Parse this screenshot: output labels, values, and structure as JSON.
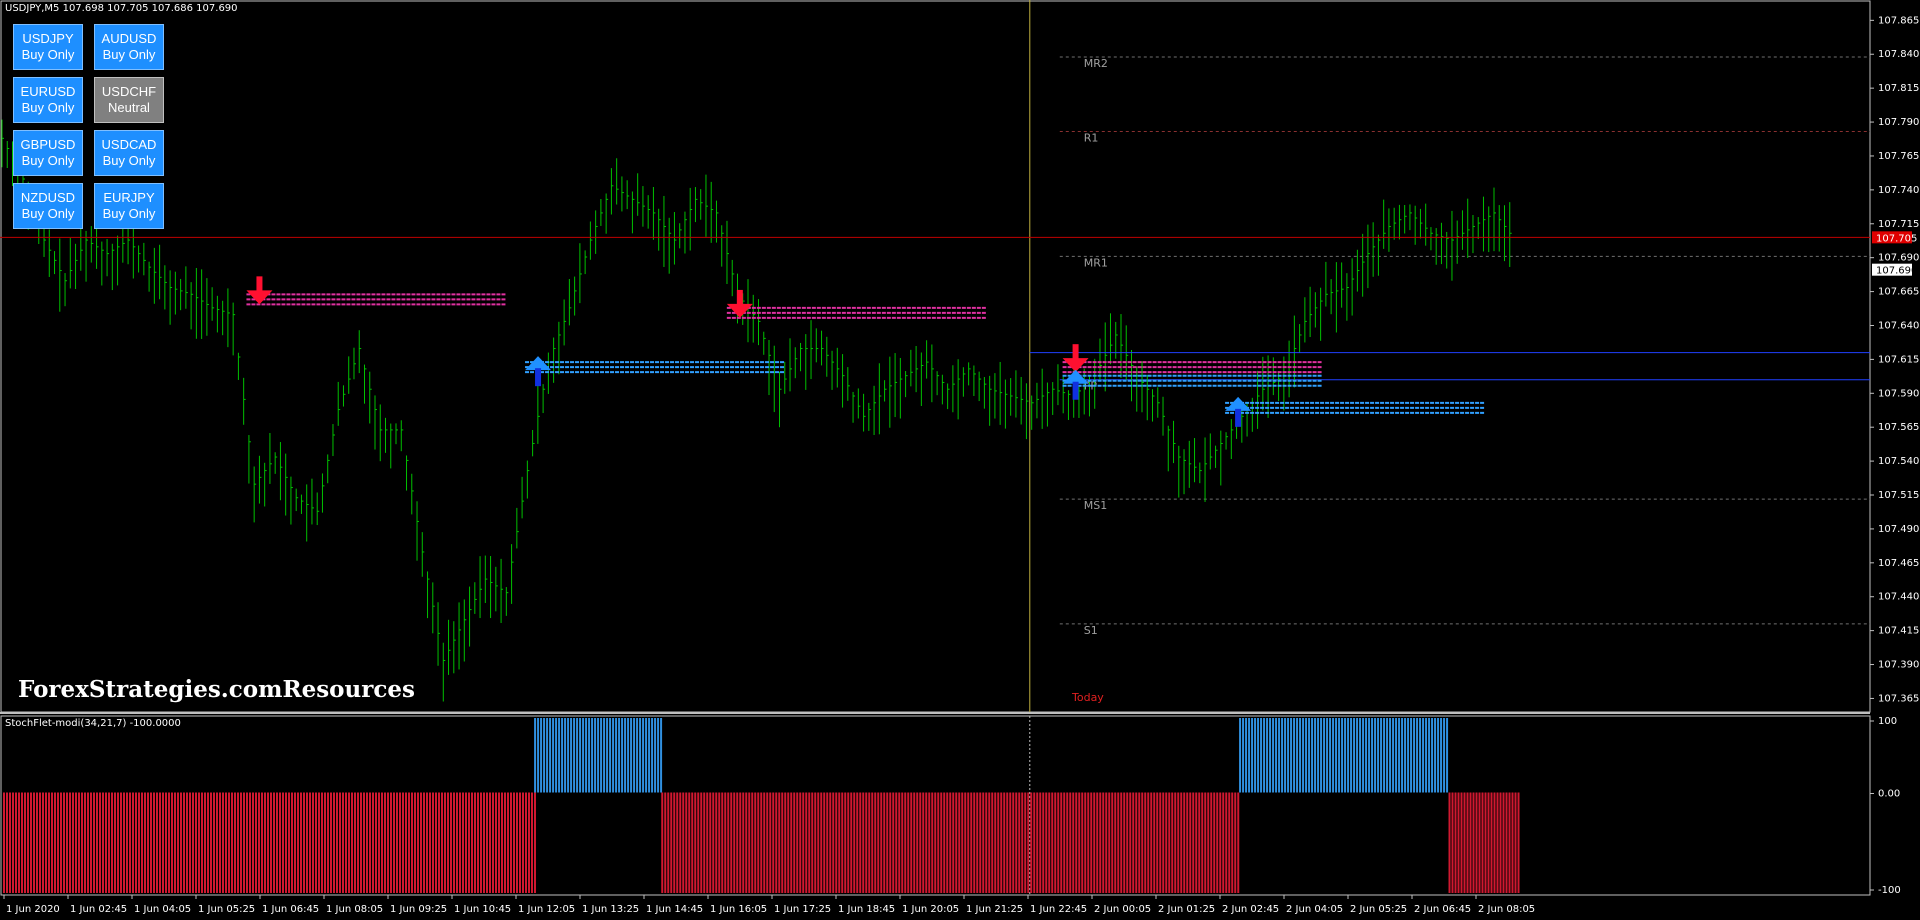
{
  "window": {
    "symbol_info": "USDJPY,M5  107.698 107.705 107.686 107.690"
  },
  "buttons": [
    {
      "pair": "USDJPY",
      "mode": "Buy Only",
      "neutral": false
    },
    {
      "pair": "AUDUSD",
      "mode": "Buy Only",
      "neutral": false
    },
    {
      "pair": "EURUSD",
      "mode": "Buy Only",
      "neutral": false
    },
    {
      "pair": "USDCHF",
      "mode": "Neutral",
      "neutral": true
    },
    {
      "pair": "GBPUSD",
      "mode": "Buy Only",
      "neutral": false
    },
    {
      "pair": "USDCAD",
      "mode": "Buy Only",
      "neutral": false
    },
    {
      "pair": "NZDUSD",
      "mode": "Buy Only",
      "neutral": false
    },
    {
      "pair": "EURJPY",
      "mode": "Buy Only",
      "neutral": false
    }
  ],
  "watermark": "ForexStrategies.comResources",
  "today_label": "Today",
  "indicator": {
    "title": "StochFlet-modi(34,21,7) -100.0000",
    "axis": [
      "100",
      "0.00",
      "-100"
    ],
    "value": -100
  },
  "colors": {
    "candle": "#00c000",
    "bid": "#c00000",
    "ask": "#2040ff",
    "pivot": "#808080",
    "up": "#2090ff",
    "down": "#ff1030",
    "sell_line": "#e030a0",
    "buy_line": "#30a0ff"
  },
  "chart_data": {
    "type": "candlestick",
    "symbol": "USDJPY",
    "timeframe": "M5",
    "ylim": [
      107.355,
      107.88
    ],
    "y_ticks": [
      "107.865",
      "107.840",
      "107.815",
      "107.790",
      "107.765",
      "107.740",
      "107.715",
      "107.690",
      "107.665",
      "107.640",
      "107.615",
      "107.590",
      "107.565",
      "107.540",
      "107.515",
      "107.490",
      "107.465",
      "107.440",
      "107.415",
      "107.390",
      "107.365"
    ],
    "x_ticks": [
      "1 Jun 2020",
      "1 Jun 02:45",
      "1 Jun 04:05",
      "1 Jun 05:25",
      "1 Jun 06:45",
      "1 Jun 08:05",
      "1 Jun 09:25",
      "1 Jun 10:45",
      "1 Jun 12:05",
      "1 Jun 13:25",
      "1 Jun 14:45",
      "1 Jun 16:05",
      "1 Jun 17:25",
      "1 Jun 18:45",
      "1 Jun 20:05",
      "1 Jun 21:25",
      "1 Jun 22:45",
      "2 Jun 00:05",
      "2 Jun 01:25",
      "2 Jun 02:45",
      "2 Jun 04:05",
      "2 Jun 05:25",
      "2 Jun 06:45",
      "2 Jun 08:05"
    ],
    "price_path": [
      107.775,
      107.745,
      107.7,
      107.67,
      107.7,
      107.69,
      107.7,
      107.68,
      107.665,
      107.66,
      107.65,
      107.645,
      107.52,
      107.54,
      107.51,
      107.5,
      107.575,
      107.62,
      107.56,
      107.56,
      107.47,
      107.39,
      107.42,
      107.45,
      107.44,
      107.53,
      107.61,
      107.65,
      107.7,
      107.74,
      107.73,
      107.72,
      107.7,
      107.73,
      107.72,
      107.66,
      107.64,
      107.59,
      107.62,
      107.62,
      107.6,
      107.57,
      107.59,
      107.6,
      107.61,
      107.59,
      107.605,
      107.59,
      107.585,
      107.58,
      107.59,
      107.585,
      107.6,
      107.63,
      107.6,
      107.58,
      107.54,
      107.53,
      107.55,
      107.57,
      107.59,
      107.6,
      107.64,
      107.66,
      107.665,
      107.69,
      107.71,
      107.72,
      107.705,
      107.7,
      107.71,
      107.72,
      107.7
    ],
    "pivots": [
      {
        "label": "MR2",
        "value": 107.838
      },
      {
        "label": "R1",
        "value": 107.783
      },
      {
        "label": "MR1",
        "value": 107.691
      },
      {
        "label": "PP",
        "value": 107.6
      },
      {
        "label": "MS1",
        "value": 107.512
      },
      {
        "label": "S1",
        "value": 107.42
      }
    ],
    "bid": 107.705,
    "ask": 107.69,
    "bid_label": "107.705",
    "ask_label": "107.690",
    "signals": [
      {
        "dir": "sell",
        "x_frac": 0.138,
        "y": 107.66
      },
      {
        "dir": "buy",
        "x_frac": 0.294,
        "y": 107.61
      },
      {
        "dir": "sell",
        "x_frac": 0.407,
        "y": 107.65
      },
      {
        "dir": "sell",
        "x_frac": 0.595,
        "y": 107.61
      },
      {
        "dir": "buy",
        "x_frac": 0.595,
        "y": 107.6
      },
      {
        "dir": "buy",
        "x_frac": 0.686,
        "y": 107.58
      }
    ],
    "indicator_segments": [
      {
        "from": 0.0,
        "to": 0.284,
        "value": -100
      },
      {
        "from": 0.284,
        "to": 0.352,
        "value": 100
      },
      {
        "from": 0.352,
        "to": 0.661,
        "value": -100
      },
      {
        "from": 0.661,
        "to": 0.773,
        "value": 100
      },
      {
        "from": 0.773,
        "to": 0.81,
        "value": -100
      }
    ],
    "today_x_frac": 0.58
  }
}
